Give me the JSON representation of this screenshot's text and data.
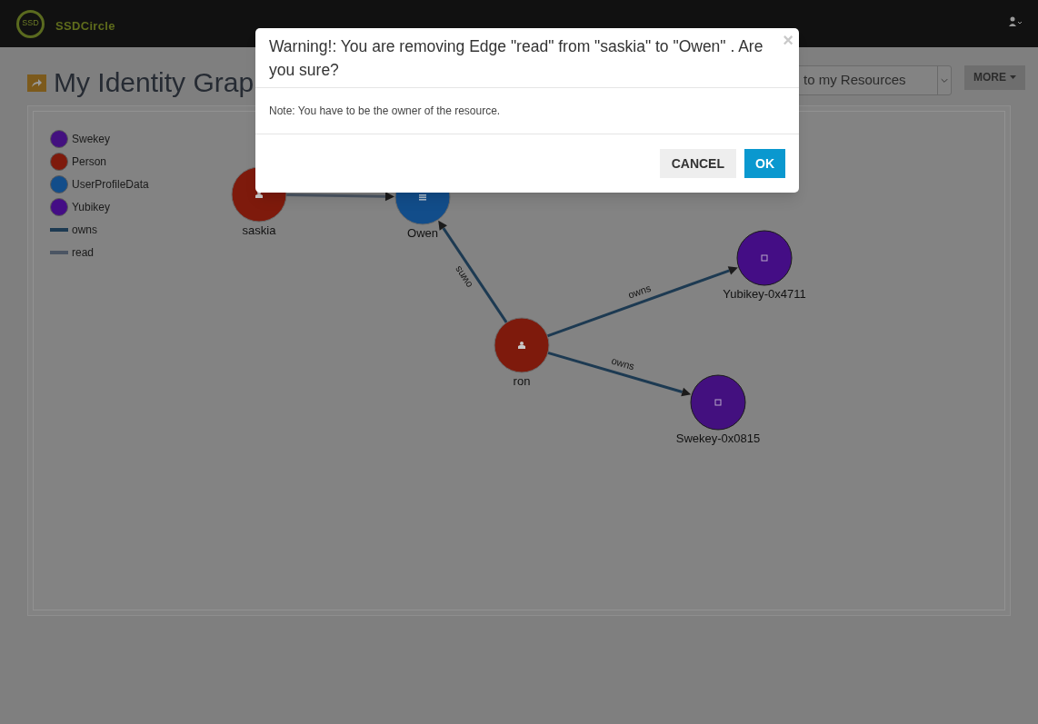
{
  "topbar": {
    "logo_text": "SSD",
    "brand": "SSDCircle"
  },
  "page_title": "My Identity Grap",
  "resource_select": {
    "value": "to my Resources"
  },
  "more_button": "MORE",
  "legend": [
    {
      "label": "Swekey",
      "kind": "node",
      "color": "#43107f"
    },
    {
      "label": "Person",
      "kind": "node",
      "color": "#7e1a0c"
    },
    {
      "label": "UserProfileData",
      "kind": "node",
      "color": "#124d8a"
    },
    {
      "label": "Yubikey",
      "kind": "node",
      "color": "#440d85"
    },
    {
      "label": "owns",
      "kind": "edge",
      "color": "#1d3a52"
    },
    {
      "label": "read",
      "kind": "edge",
      "color": "#4b5563"
    }
  ],
  "graph": {
    "nodes": [
      {
        "label": "saskia",
        "kind": "person",
        "color": "#7e1a0c"
      },
      {
        "label": "Owen",
        "kind": "profile",
        "color": "#124d8a"
      },
      {
        "label": "ron",
        "kind": "person",
        "color": "#7e1a0c"
      },
      {
        "label": "Yubikey-0x4711",
        "kind": "device",
        "color": "#440d85"
      },
      {
        "label": "Swekey-0x0815",
        "kind": "device",
        "color": "#43107f"
      }
    ],
    "edges": [
      {
        "kind": "read"
      },
      {
        "kind": "owns",
        "label": "owns"
      },
      {
        "kind": "owns",
        "label": "owns"
      },
      {
        "kind": "owns",
        "label": "owns"
      }
    ]
  },
  "dialog": {
    "title": "Warning!: You are removing Edge \"read\" from \"saskia\" to \"Owen\" . Are you sure?",
    "close": "×",
    "note": "Note: You have to be the owner of the resource.",
    "buttons": [
      {
        "label": "CANCEL",
        "kind": "secondary"
      },
      {
        "label": "OK",
        "kind": "primary"
      }
    ]
  }
}
